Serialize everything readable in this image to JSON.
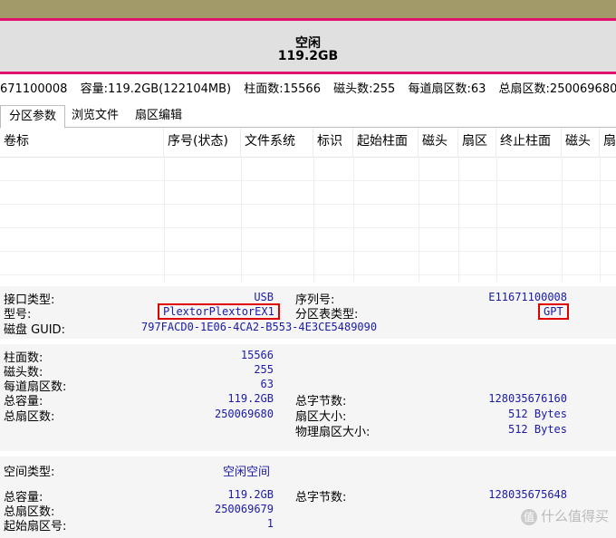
{
  "disk_bar": {
    "status": "空闲",
    "size": "119.2GB"
  },
  "info_line": {
    "serial_partial": "671100008",
    "capacity": "容量:119.2GB(122104MB)",
    "cylinders": "柱面数:15566",
    "heads": "磁头数:255",
    "sectors_per_track": "每道扇区数:63",
    "total_sectors": "总扇区数:250069680"
  },
  "tabs": [
    "分区参数",
    "浏览文件",
    "扇区编辑"
  ],
  "table": {
    "columns": [
      "卷标",
      "序号(状态)",
      "文件系统",
      "标识",
      "起始柱面",
      "磁头",
      "扇区",
      "终止柱面",
      "磁头",
      "扇"
    ]
  },
  "disk_info": {
    "interface_label": "接口类型:",
    "interface": "USB",
    "model_label": "型号:",
    "model": "PlextorPlextorEX1",
    "guid_label": "磁盘 GUID:",
    "guid": "797FACD0-1E06-4CA2-B553-4E3CE5489090",
    "serial_label": "序列号:",
    "serial": "E11671100008",
    "pt_label": "分区表类型:",
    "pt": "GPT"
  },
  "geometry": {
    "cyl_label": "柱面数:",
    "cyl": "15566",
    "heads_label": "磁头数:",
    "heads": "255",
    "spt_label": "每道扇区数:",
    "spt": "63",
    "cap_label": "总容量:",
    "cap": "119.2GB",
    "ts_label": "总扇区数:",
    "ts": "250069680",
    "tb_label": "总字节数:",
    "tb": "128035676160",
    "ss_label": "扇区大小:",
    "ss": "512 Bytes",
    "pss_label": "物理扇区大小:",
    "pss": "512 Bytes"
  },
  "space": {
    "type_label": "空间类型:",
    "type": "空闲空间",
    "cap_label": "总容量:",
    "cap": "119.2GB",
    "ts_label": "总扇区数:",
    "ts": "250069679",
    "start_label": "起始扇区号:",
    "start": "1",
    "tb_label": "总字节数:",
    "tb": "128035675648"
  },
  "watermark": {
    "icon": "值",
    "text": "什么值得买"
  }
}
